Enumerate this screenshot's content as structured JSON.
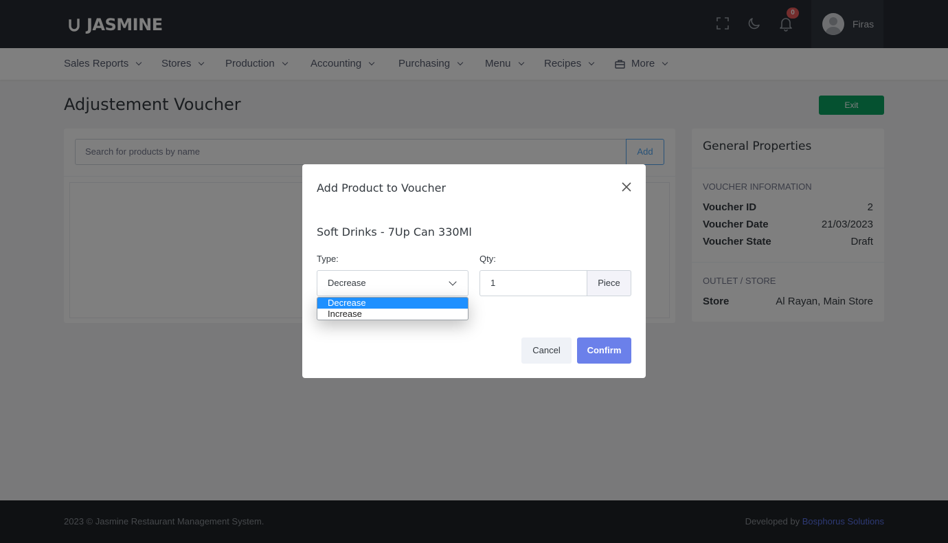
{
  "header": {
    "brand": "JASMINE",
    "notification_count": "0",
    "user_name": "Firas"
  },
  "nav": {
    "items": [
      {
        "label": "Sales Reports"
      },
      {
        "label": "Stores"
      },
      {
        "label": "Production"
      },
      {
        "label": "Accounting"
      },
      {
        "label": "Purchasing"
      },
      {
        "label": "Menu"
      },
      {
        "label": "Recipes"
      },
      {
        "label": "More"
      }
    ]
  },
  "page": {
    "title": "Adjustement Voucher",
    "exit_label": "Exit",
    "search_placeholder": "Search for products by name",
    "add_label": "Add"
  },
  "side": {
    "title": "General Properties",
    "voucher_section": "VOUCHER INFORMATION",
    "voucher_rows": [
      {
        "key": "Voucher ID",
        "value": "2"
      },
      {
        "key": "Voucher Date",
        "value": "21/03/2023"
      },
      {
        "key": "Voucher State",
        "value": "Draft"
      }
    ],
    "outlet_section": "OUTLET / STORE",
    "store_key": "Store",
    "store_value": "Al Rayan, Main Store"
  },
  "footer": {
    "copyright": "2023 © Jasmine Restaurant Management System.",
    "developed_by": "Developed by ",
    "developer": "Bosphorus Solutions"
  },
  "modal": {
    "title": "Add Product to Voucher",
    "product": "Soft Drinks - 7Up Can 330Ml",
    "type_label": "Type:",
    "type_value": "Decrease",
    "type_options": [
      "Decrease",
      "Increase"
    ],
    "qty_label": "Qty:",
    "qty_value": "1",
    "qty_unit": "Piece",
    "cancel_label": "Cancel",
    "confirm_label": "Confirm"
  },
  "colors": {
    "topbar": "#262b33",
    "exit_green": "#0ba360",
    "primary": "#5b73e8",
    "dropdown_selected": "#1e90ff"
  }
}
